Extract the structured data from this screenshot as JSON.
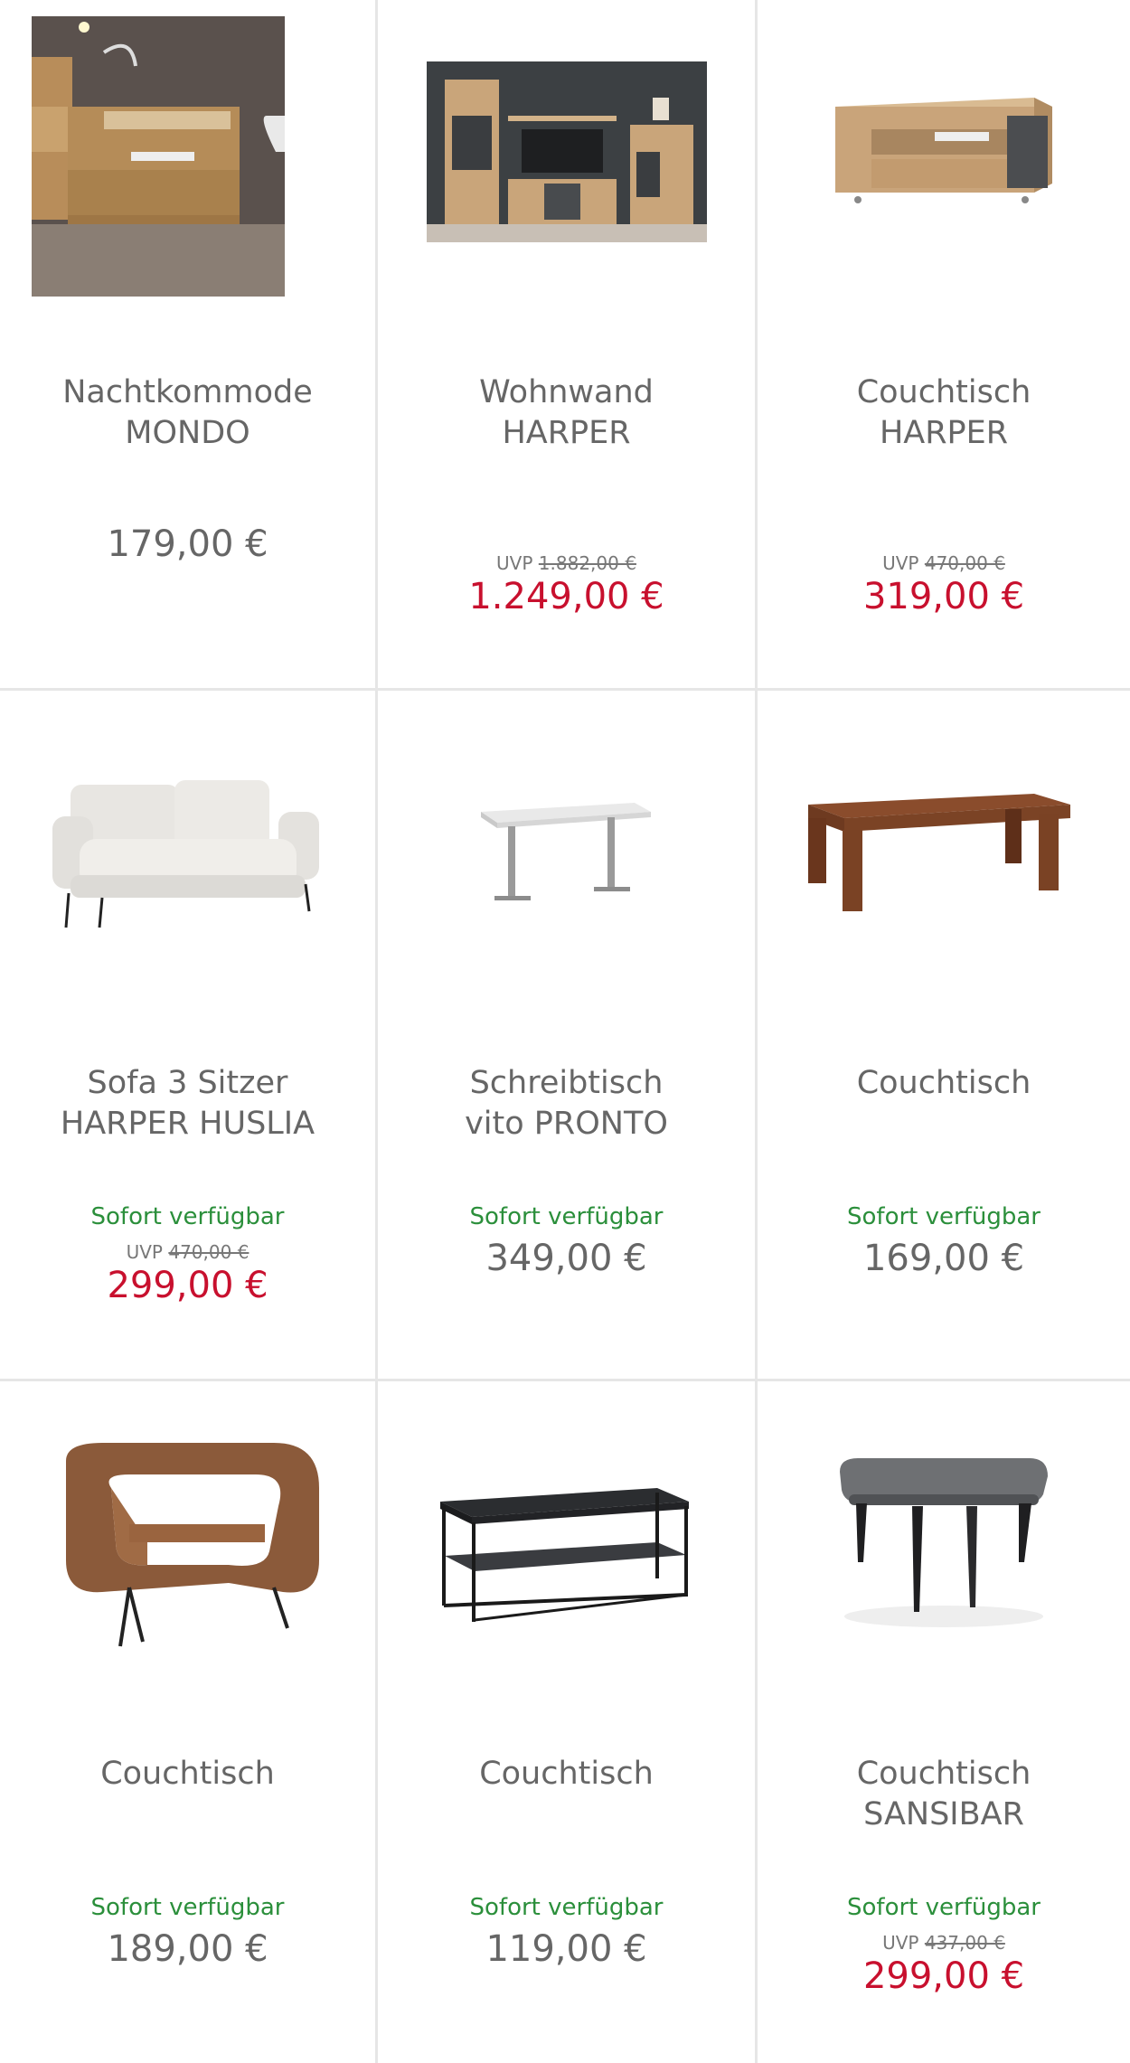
{
  "products": [
    {
      "title_line1": "Nachtkommode",
      "title_line2": "MONDO",
      "availability": "",
      "uvp_label": "",
      "uvp_price": "",
      "price": "179,00 €",
      "sale": false,
      "image_icon": "nightstand-photo"
    },
    {
      "title_line1": "Wohnwand",
      "title_line2": "HARPER",
      "availability": "",
      "uvp_label": "UVP",
      "uvp_price": "1.882,00 €",
      "price": "1.249,00 €",
      "sale": true,
      "image_icon": "wall-unit-photo"
    },
    {
      "title_line1": "Couchtisch",
      "title_line2": "HARPER",
      "availability": "",
      "uvp_label": "UVP",
      "uvp_price": "470,00 €",
      "price": "319,00 €",
      "sale": true,
      "image_icon": "coffee-table-drawer-photo"
    },
    {
      "title_line1": "Sofa 3 Sitzer",
      "title_line2": "HARPER HUSLIA",
      "availability": "Sofort verfügbar",
      "uvp_label": "UVP",
      "uvp_price": "470,00 €",
      "price": "299,00 €",
      "sale": true,
      "image_icon": "sofa-photo"
    },
    {
      "title_line1": "Schreibtisch",
      "title_line2": "vito PRONTO",
      "availability": "Sofort verfügbar",
      "uvp_label": "",
      "uvp_price": "",
      "price": "349,00 €",
      "sale": false,
      "image_icon": "desk-photo"
    },
    {
      "title_line1": "Couchtisch",
      "title_line2": "",
      "availability": "Sofort verfügbar",
      "uvp_label": "",
      "uvp_price": "",
      "price": "169,00 €",
      "sale": false,
      "image_icon": "wood-coffee-table-photo"
    },
    {
      "title_line1": "Couchtisch",
      "title_line2": "",
      "availability": "Sofort verfügbar",
      "uvp_label": "",
      "uvp_price": "",
      "price": "189,00 €",
      "sale": false,
      "image_icon": "curved-coffee-table-photo"
    },
    {
      "title_line1": "Couchtisch",
      "title_line2": "",
      "availability": "Sofort verfügbar",
      "uvp_label": "",
      "uvp_price": "",
      "price": "119,00 €",
      "sale": false,
      "image_icon": "metal-coffee-table-photo"
    },
    {
      "title_line1": "Couchtisch",
      "title_line2": "SANSIBAR",
      "availability": "Sofort verfügbar",
      "uvp_label": "UVP",
      "uvp_price": "437,00 €",
      "price": "299,00 €",
      "sale": true,
      "image_icon": "grey-coffee-table-photo"
    }
  ],
  "colors": {
    "sale_price": "#c8102e",
    "regular_price": "#666666",
    "availability": "#2b8f3b",
    "divider": "#e6e6e6"
  }
}
